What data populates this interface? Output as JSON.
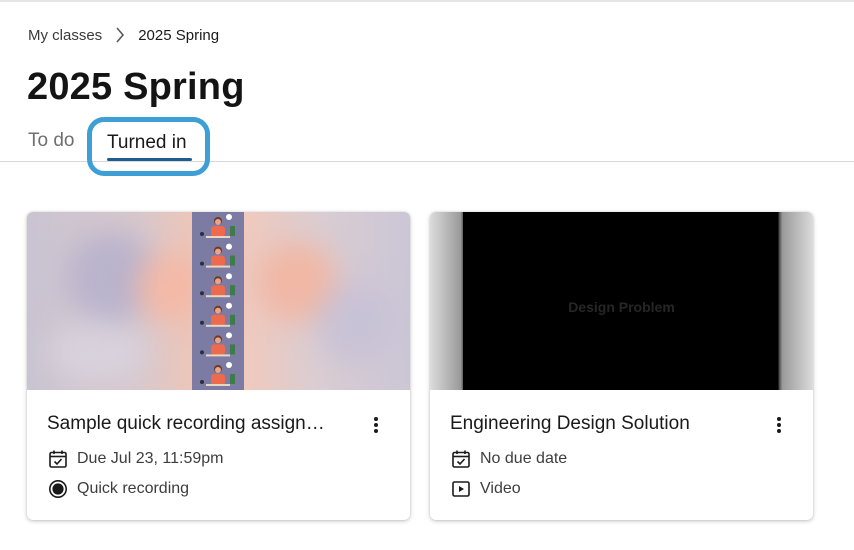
{
  "breadcrumb": {
    "parent": "My classes",
    "current": "2025 Spring"
  },
  "page": {
    "title": "2025 Spring"
  },
  "tabs": [
    {
      "label": "To do",
      "selected": false
    },
    {
      "label": "Turned in",
      "selected": true
    }
  ],
  "cards": [
    {
      "title": "Sample quick recording assignm...",
      "due": "Due Jul 23, 11:59pm",
      "type": "Quick recording",
      "type_icon": "record-icon",
      "due_icon": "calendar-check-icon"
    },
    {
      "title": "Engineering Design Solution",
      "due": "No due date",
      "type": "Video",
      "type_icon": "video-play-icon",
      "due_icon": "calendar-check-icon",
      "thumbnail_text": "Design Problem"
    }
  ],
  "colors": {
    "tab_highlight": "#3d9fd6",
    "tab_underline": "#1f5e8c",
    "text_primary": "#1a1a1a",
    "text_muted": "#6f6f6f"
  }
}
